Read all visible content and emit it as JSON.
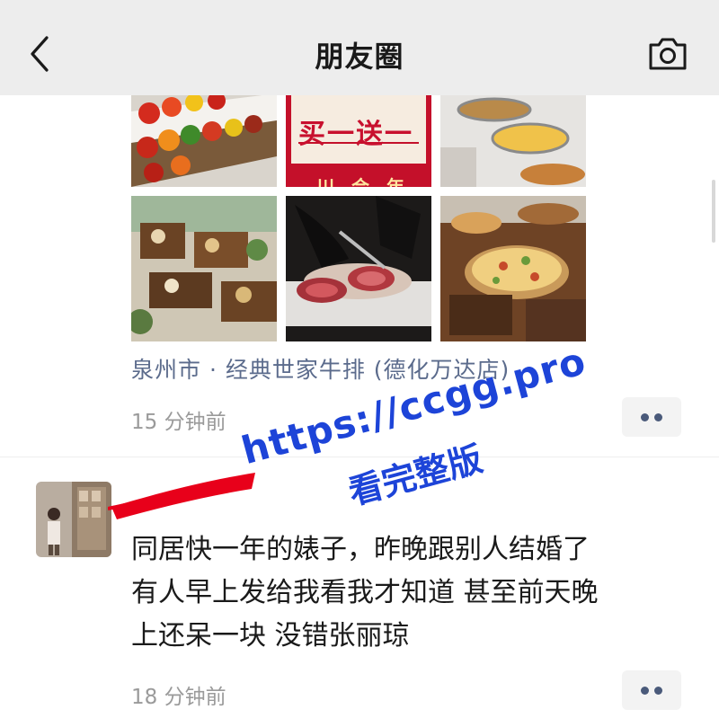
{
  "header": {
    "title": "朋友圈",
    "back_icon": "chevron-left-icon",
    "camera_icon": "camera-icon"
  },
  "post1": {
    "photos": [
      {
        "subject": "fruit buffet tray"
      },
      {
        "subject": "promotion poster",
        "promo_text": "买一送一",
        "promo_text_2": "川 合 年 川"
      },
      {
        "subject": "buffet dishes"
      },
      {
        "subject": "dessert buffet"
      },
      {
        "subject": "steak being cut"
      },
      {
        "subject": "pizza on wooden board"
      }
    ],
    "location": "泉州市 · 经典世家牛排 (德化万达店)",
    "time": "15 分钟前",
    "more_icon": "more-dots-icon"
  },
  "post2": {
    "lines": [
      "同居快一年的婊子，昨晚跟别人结婚了",
      "有人早上发给我看我才知道 甚至前天晚",
      "上还呆一块 没错张丽琼"
    ],
    "time": "18 分钟前",
    "more_icon": "more-dots-icon"
  },
  "watermark": {
    "line1": "https://ccgg.pro",
    "line2": "看完整版"
  },
  "colors": {
    "header_bg": "#ededed",
    "link_blue": "#5b6b8c",
    "time_gray": "#9a9a9a",
    "watermark_blue": "#1d44d8",
    "redaction_red": "#e8001a"
  }
}
